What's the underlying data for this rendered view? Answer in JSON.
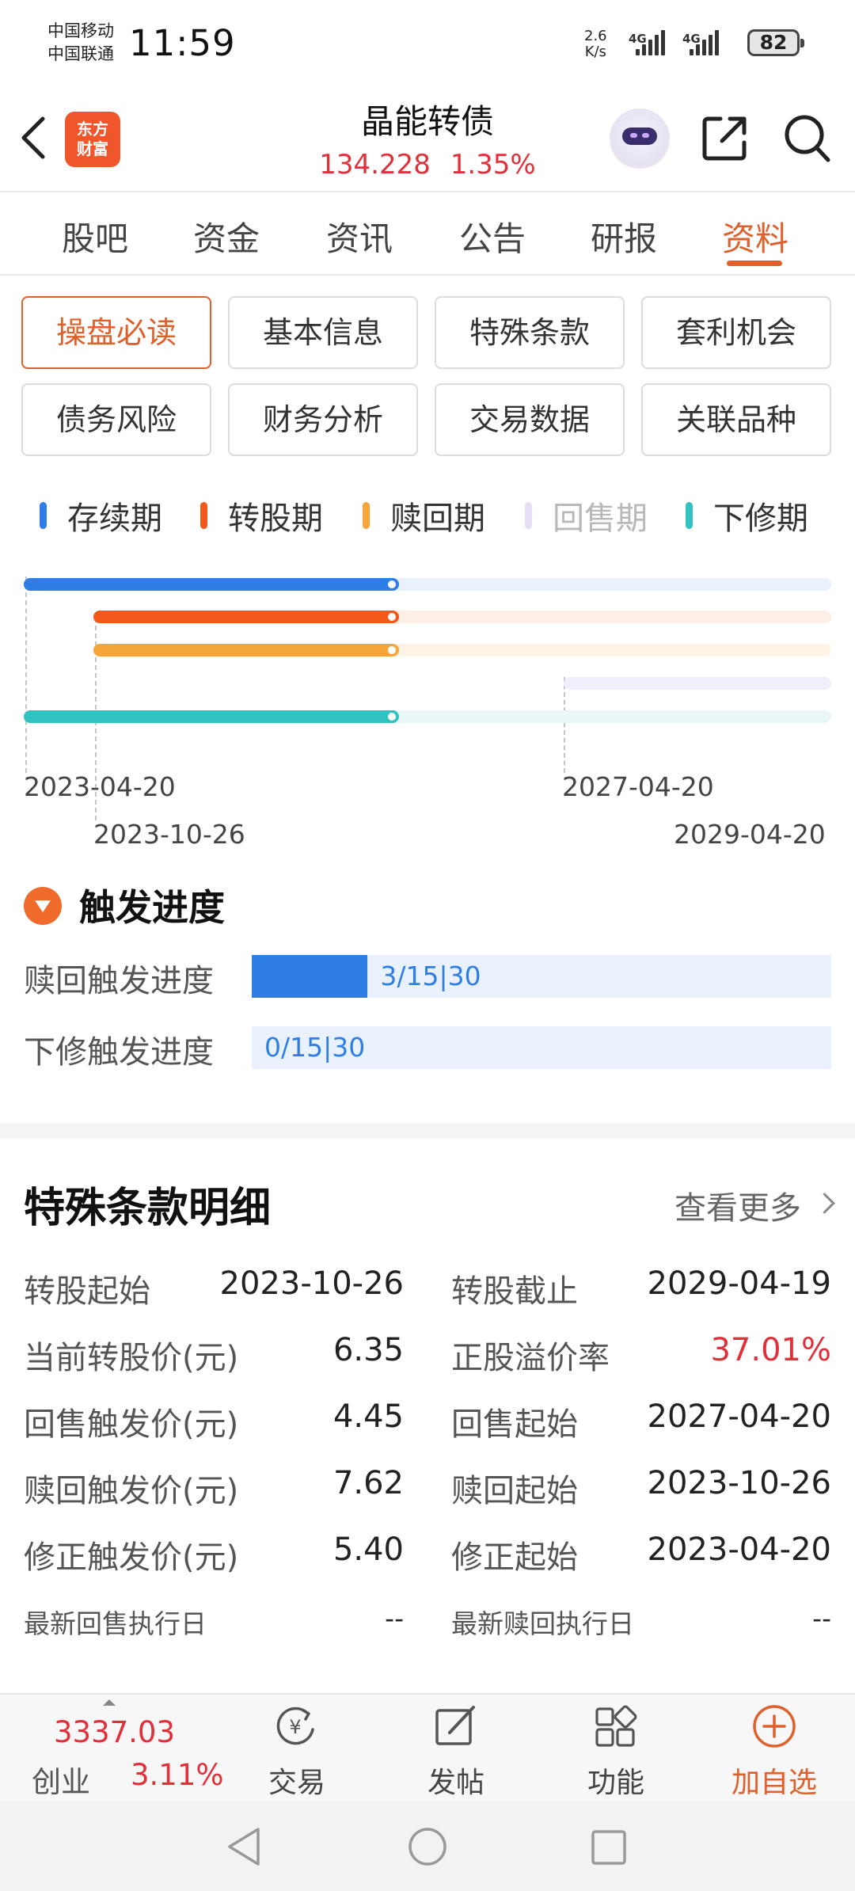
{
  "status_bar": {
    "carrier1": "中国移动",
    "carrier2": "中国联通",
    "time": "11:59",
    "speed_value": "2.6",
    "speed_unit": "K/s",
    "network1": "4G",
    "network2": "4G",
    "battery": "82"
  },
  "header": {
    "logo_line1": "东方",
    "logo_line2": "财富",
    "title": "晶能转债",
    "price": "134.228",
    "change": "1.35%"
  },
  "tabs": [
    "股吧",
    "资金",
    "资讯",
    "公告",
    "研报",
    "资料"
  ],
  "active_tab": "资料",
  "sections": [
    "操盘必读",
    "基本信息",
    "特殊条款",
    "套利机会",
    "债务风险",
    "财务分析",
    "交易数据",
    "关联品种"
  ],
  "active_section": "操盘必读",
  "legend": [
    {
      "label": "存续期",
      "color": "#2f7ee6"
    },
    {
      "label": "转股期",
      "color": "#f2581a"
    },
    {
      "label": "赎回期",
      "color": "#f5a63a"
    },
    {
      "label": "回售期",
      "color": "#e6def7"
    },
    {
      "label": "下修期",
      "color": "#33c2c2"
    }
  ],
  "timeline": {
    "current_progress": 0.465,
    "dates": {
      "start": "2023-04-20",
      "convert_start": "2023-10-26",
      "putback_start": "2027-04-20",
      "end": "2029-04-20"
    }
  },
  "trigger": {
    "title": "触发进度",
    "redeem_label": "赎回触发进度",
    "redeem_text": "3/15|30",
    "redeem_progress": 0.2,
    "revise_label": "下修触发进度",
    "revise_text": "0/15|30",
    "revise_progress": 0
  },
  "terms": {
    "title": "特殊条款明细",
    "more": "查看更多",
    "rows": [
      {
        "l1": "转股起始",
        "v1": "2023-10-26",
        "l2": "转股截止",
        "v2": "2029-04-19"
      },
      {
        "l1": "当前转股价(元)",
        "v1": "6.35",
        "l2": "正股溢价率",
        "v2": "37.01%"
      },
      {
        "l1": "回售触发价(元)",
        "v1": "4.45",
        "l2": "回售起始",
        "v2": "2027-04-20"
      },
      {
        "l1": "赎回触发价(元)",
        "v1": "7.62",
        "l2": "赎回起始",
        "v2": "2023-10-26"
      },
      {
        "l1": "修正触发价(元)",
        "v1": "5.40",
        "l2": "修正起始",
        "v2": "2023-04-20"
      },
      {
        "l1": "最新回售执行日",
        "v1": "--",
        "l2": "最新赎回执行日",
        "v2": "--"
      }
    ]
  },
  "toolbar": {
    "index_value": "3337.03",
    "index_name": "创业",
    "index_change": "3.11%",
    "trade": "交易",
    "post": "发帖",
    "function": "功能",
    "add": "加自选"
  },
  "colors": {
    "accent": "#e0602b",
    "up": "#e0303a",
    "blue": "#2f7ee6"
  }
}
